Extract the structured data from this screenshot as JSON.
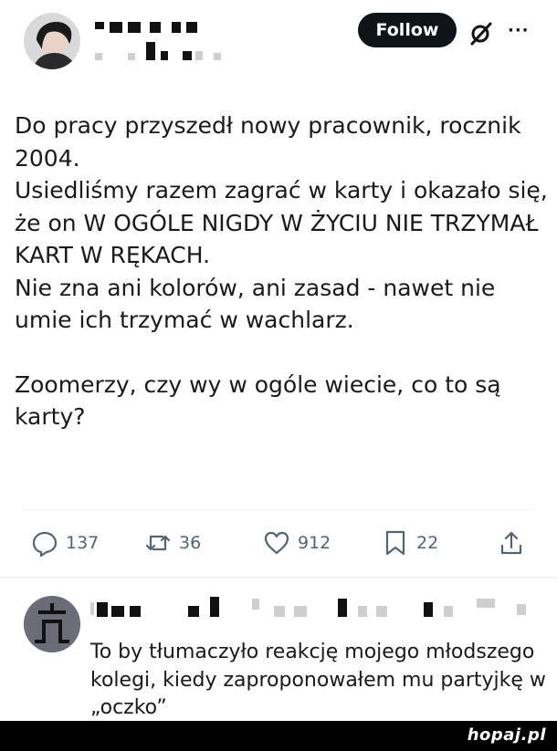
{
  "header": {
    "follow_label": "Follow",
    "grok_icon": "grok-icon",
    "more_icon": "more-icon",
    "more_glyph": "···"
  },
  "tweet": {
    "paragraphs": [
      "Do pracy przyszedł nowy pracownik, rocznik 2004.",
      "Usiedliśmy razem zagrać w karty i okazało się, że on W OGÓLE NIGDY W ŻYCIU NIE TRZYMAŁ KART W RĘKACH.",
      "Nie zna ani kolorów, ani zasad - nawet nie umie ich trzymać w wachlarz.",
      "Zoomerzy, czy wy w ogóle wiecie, co to są karty?"
    ]
  },
  "actions": {
    "replies": "137",
    "reposts": "36",
    "likes": "912",
    "bookmarks": "22"
  },
  "reply": {
    "text": "To by tłumaczyło reakcję mojego młodszego kolegi, kiedy zaproponowałem mu partyjkę w „oczko”"
  },
  "watermark": {
    "text": "hopaj.pl"
  }
}
